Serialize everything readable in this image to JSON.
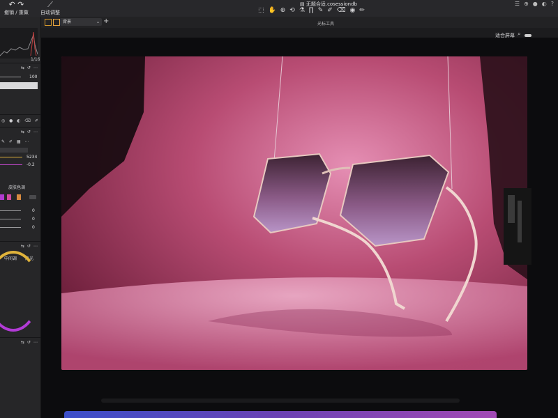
{
  "toolbar": {
    "reset_undo_label": "撤销 / 重做",
    "auto_adjust_label": "自动调整",
    "document_title": "无题合适.cosessiondb",
    "tools": [
      "⬚",
      "✋",
      "⊕",
      "⟲",
      "⚗",
      "∏",
      "✎",
      "✐",
      "⌫",
      "◉",
      "✏",
      "⋯"
    ],
    "window_controls": [
      "☰",
      "⊕",
      "●",
      "◐",
      "?"
    ]
  },
  "subbar": {
    "dropdown_value": "背景",
    "cursor_tools_label": "光标工具"
  },
  "viewbar": {
    "fit_label": "适合屏幕"
  },
  "left_panel": {
    "histogram_value": "1/16",
    "slider_values": [
      "100"
    ],
    "wb_values": [
      "5234",
      "-0.2"
    ],
    "skin_tone_label": "皮肤色调",
    "number_values": [
      "0",
      "0",
      "0"
    ],
    "tone_labels": [
      "中间调",
      "高光"
    ]
  },
  "colors": {
    "accent": "#f19a2a",
    "backdrop": "#b04a6a",
    "lens_top": "#3c2232",
    "lens_bottom": "#b894c7"
  }
}
